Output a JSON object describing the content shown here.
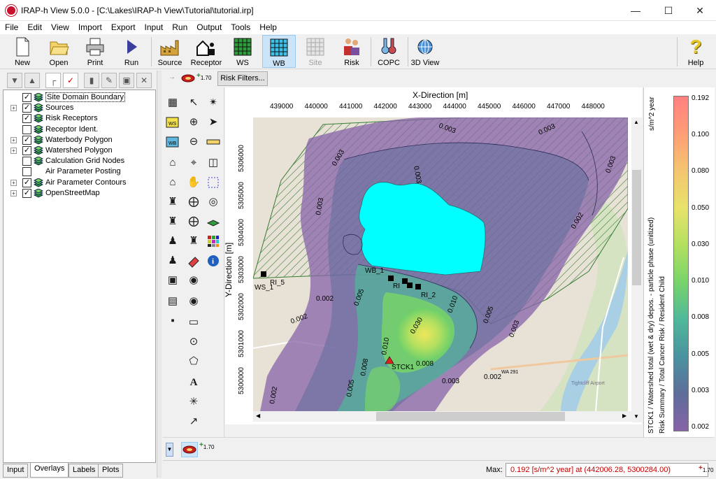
{
  "window": {
    "title": "IRAP-h View 5.0.0 - [C:\\Lakes\\IRAP-h View\\Tutorial\\tutorial.irp]",
    "minimize": "—",
    "maximize": "☐",
    "close": "✕"
  },
  "menu": [
    "File",
    "Edit",
    "View",
    "Import",
    "Export",
    "Input",
    "Run",
    "Output",
    "Tools",
    "Help"
  ],
  "toolbar": {
    "new": "New",
    "open": "Open",
    "print": "Print",
    "run": "Run",
    "source": "Source",
    "receptor": "Receptor",
    "ws": "WS",
    "wb": "WB",
    "site": "Site",
    "risk": "Risk",
    "copc": "COPC",
    "view3d": "3D View",
    "help": "Help"
  },
  "left_panel": {
    "tree": [
      {
        "label": "Site Domain Boundary",
        "checked": true,
        "expandable": false,
        "layer_icon": true
      },
      {
        "label": "Sources",
        "checked": true,
        "expandable": true,
        "layer_icon": true
      },
      {
        "label": "Risk Receptors",
        "checked": true,
        "expandable": false,
        "layer_icon": true
      },
      {
        "label": "Receptor Ident.",
        "checked": false,
        "expandable": false,
        "layer_icon": true
      },
      {
        "label": "Waterbody Polygon",
        "checked": true,
        "expandable": true,
        "layer_icon": true
      },
      {
        "label": "Watershed Polygon",
        "checked": true,
        "expandable": true,
        "layer_icon": true
      },
      {
        "label": "Calculation Grid Nodes",
        "checked": false,
        "expandable": false,
        "layer_icon": true
      },
      {
        "label": "Air Parameter Posting",
        "checked": false,
        "expandable": false,
        "layer_icon": false
      },
      {
        "label": "Air Parameter Contours",
        "checked": true,
        "expandable": true,
        "layer_icon": true
      },
      {
        "label": "OpenStreetMap",
        "checked": true,
        "expandable": true,
        "layer_icon": true
      }
    ],
    "tabs": [
      "Input",
      "Overlays",
      "Labels",
      "Plots"
    ],
    "selected_tab": "Overlays"
  },
  "ribbon2": {
    "risk_filters": "Risk Filters...",
    "unit_tag": "1.70",
    "plus": "+"
  },
  "plot": {
    "x_title": "X-Direction [m]",
    "y_title": "Y-Direction [m]",
    "x_ticks": [
      "439000",
      "440000",
      "441000",
      "442000",
      "443000",
      "444000",
      "445000",
      "446000",
      "447000",
      "448000"
    ],
    "y_ticks": [
      "5306000",
      "5305000",
      "5304000",
      "5303000",
      "5302000",
      "5301000",
      "5300000"
    ],
    "map_labels": {
      "wb": "WB_1",
      "ws": "WS_1",
      "ri5": "RI_5",
      "ri": "RI",
      "ri2": "RI_2",
      "stck": "STCK1",
      "contours": [
        "0.003",
        "0.003",
        "0.003",
        "0.003",
        "0.003",
        "0.003",
        "0.002",
        "0.002",
        "0.002",
        "0.002",
        "0.005",
        "0.005",
        "0.008",
        "0.008",
        "0.010",
        "0.010",
        "0.030",
        "0.005",
        "0.003",
        "0.003",
        "0.002"
      ],
      "road_wa291": "WA 291",
      "road_wa": "WA",
      "airport": "Tightcliff Airport"
    }
  },
  "legend": {
    "unit": "s/m^2 year",
    "description": "STCK1 / Watershed total (wet & dry) depos. - particle phase (unitized)",
    "description2": "Risk Summary / Total Cancer Risk / Resident Child",
    "values": [
      "0.192",
      "0.100",
      "0.080",
      "0.050",
      "0.030",
      "0.010",
      "0.008",
      "0.005",
      "0.003",
      "0.002"
    ],
    "colors": [
      "#ff8080",
      "#ff9e76",
      "#f4c56f",
      "#e8e36b",
      "#b3e060",
      "#78d46a",
      "#4fb89a",
      "#4a93a0",
      "#5e6d9a",
      "#8763a8"
    ]
  },
  "status": {
    "max_label": "Max:",
    "max_value": "0.192  [s/m^2 year]  at  (442006.28, 5300284.00)"
  }
}
